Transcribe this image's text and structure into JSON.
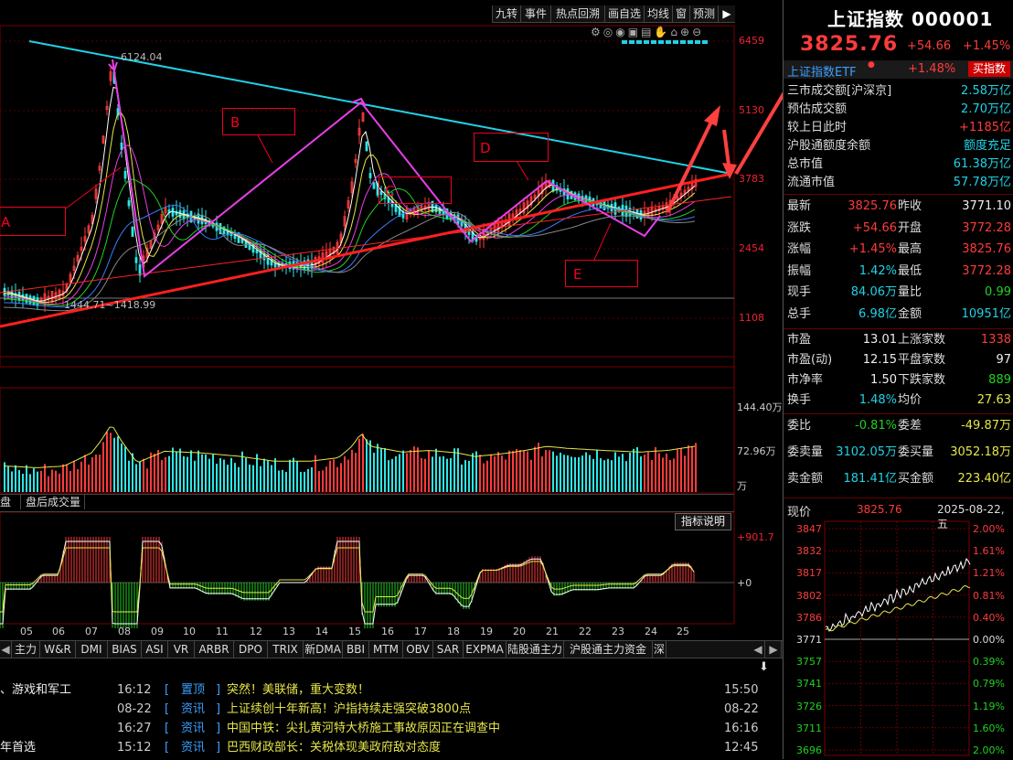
{
  "toolbar": {
    "buttons": [
      "九转",
      "事件",
      "热点回溯",
      "画自选",
      "均线",
      "窗",
      "预测"
    ]
  },
  "main_chart": {
    "price_axis": [
      "6459",
      "5130",
      "3783",
      "2454",
      "1108"
    ],
    "high_label": "6124.04",
    "low_label": "1444.71~1418.99",
    "pattern_labels": [
      "A",
      "B",
      "C",
      "D",
      "E"
    ]
  },
  "volume_chart": {
    "axis": [
      "144.40万",
      "72.96万",
      "万"
    ],
    "tabs": [
      "盘",
      "盘后成交量"
    ]
  },
  "indicator_chart": {
    "title_button": "指标说明",
    "axis": [
      "+901.7",
      "+0"
    ]
  },
  "time_axis": [
    "05",
    "06",
    "07",
    "08",
    "09",
    "10",
    "11",
    "12",
    "13",
    "14",
    "15",
    "16",
    "17",
    "18",
    "19",
    "20",
    "21",
    "22",
    "23",
    "24",
    "25"
  ],
  "indicator_tabs": [
    "主力",
    "W&R",
    "DMI",
    "BIAS",
    "ASI",
    "VR",
    "ARBR",
    "DPO",
    "TRIX",
    "新DMA",
    "BBI",
    "MTM",
    "OBV",
    "SAR",
    "EXPMA",
    "陆股通主力资金",
    "沪股通主力资金",
    "深"
  ],
  "news": [
    {
      "left": "、游戏和军工",
      "time": "16:12",
      "tag": "置顶",
      "title": "突然！美联储，重大变数！",
      "right_time": "15:50"
    },
    {
      "left": "",
      "time": "08-22",
      "tag": "资讯",
      "title": "上证续创十年新高！沪指持续走强突破3800点",
      "right_time": "08-22"
    },
    {
      "left": "",
      "time": "16:27",
      "tag": "资讯",
      "title": "中国中铁：尖扎黄河特大桥施工事故原因正在调查中",
      "right_time": "16:16"
    },
    {
      "left": "年首选",
      "time": "15:12",
      "tag": "资讯",
      "title": "巴西财政部长：关税体现美政府敌对态度",
      "right_time": "12:45"
    }
  ],
  "quote": {
    "title": "上证指数 000001",
    "price": "3825.76",
    "change": "+54.66",
    "change_pct": "+1.45%",
    "etf_name": "上证指数ETF",
    "etf_pct": "+1.48%",
    "buy_label": "买指数",
    "summary": [
      {
        "label": "三市成交额[沪深京]",
        "value": "2.58万亿",
        "color": "cyan"
      },
      {
        "label": "预估成交额",
        "value": "2.70万亿",
        "color": "cyan"
      },
      {
        "label": "较上日此时",
        "value": "+1185亿",
        "color": "red"
      },
      {
        "label": "沪股通额度余额",
        "value": "额度充足",
        "color": "cyan"
      },
      {
        "label": "总市值",
        "value": "61.38万亿",
        "color": "cyan"
      },
      {
        "label": "流通市值",
        "value": "57.78万亿",
        "color": "cyan"
      }
    ],
    "details": [
      {
        "l1": "最新",
        "v1": "3825.76",
        "c1": "red",
        "l2": "昨收",
        "v2": "3771.10",
        "c2": "white"
      },
      {
        "l1": "涨跌",
        "v1": "+54.66",
        "c1": "red",
        "l2": "开盘",
        "v2": "3772.28",
        "c2": "red"
      },
      {
        "l1": "涨幅",
        "v1": "+1.45%",
        "c1": "red",
        "l2": "最高",
        "v2": "3825.76",
        "c2": "red"
      },
      {
        "l1": "振幅",
        "v1": "1.42%",
        "c1": "cyan",
        "l2": "最低",
        "v2": "3772.28",
        "c2": "red"
      },
      {
        "l1": "现手",
        "v1": "84.06万",
        "c1": "cyan",
        "l2": "量比",
        "v2": "0.99",
        "c2": "green"
      },
      {
        "l1": "总手",
        "v1": "6.98亿",
        "c1": "cyan",
        "l2": "金额",
        "v2": "10951亿",
        "c2": "cyan"
      }
    ],
    "stats": [
      {
        "l1": "市盈",
        "v1": "13.01",
        "c1": "white",
        "l2": "上涨家数",
        "v2": "1338",
        "c2": "red"
      },
      {
        "l1": "市盈(动)",
        "v1": "12.15",
        "c1": "white",
        "l2": "平盘家数",
        "v2": "97",
        "c2": "white"
      },
      {
        "l1": "市净率",
        "v1": "1.50",
        "c1": "white",
        "l2": "下跌家数",
        "v2": "889",
        "c2": "green"
      },
      {
        "l1": "换手",
        "v1": "1.48%",
        "c1": "cyan",
        "l2": "均价",
        "v2": "27.63",
        "c2": "yel"
      }
    ],
    "orders": [
      {
        "l1": "委比",
        "v1": "-0.81%",
        "c1": "green",
        "l2": "委差",
        "v2": "-49.87万",
        "c2": "yel"
      },
      {
        "l1": "委卖量",
        "v1": "3102.05万",
        "c1": "cyan",
        "l2": "委买量",
        "v2": "3052.18万",
        "c2": "yel"
      },
      {
        "l1": "卖金额",
        "v1": "181.41亿",
        "c1": "cyan",
        "l2": "买金额",
        "v2": "223.40亿",
        "c2": "yel"
      }
    ]
  },
  "intraday": {
    "label": "现价",
    "price": "3825.76",
    "date": "2025-08-22,五",
    "price_axis": [
      "3847",
      "3832",
      "3817",
      "3802",
      "3786",
      "3771",
      "3757",
      "3741",
      "3726",
      "3711",
      "3696"
    ],
    "pct_axis": [
      "2.00%",
      "1.61%",
      "1.21%",
      "0.81%",
      "0.40%",
      "0.00%",
      "0.39%",
      "0.79%",
      "1.19%",
      "1.60%",
      "2.00%"
    ]
  }
}
